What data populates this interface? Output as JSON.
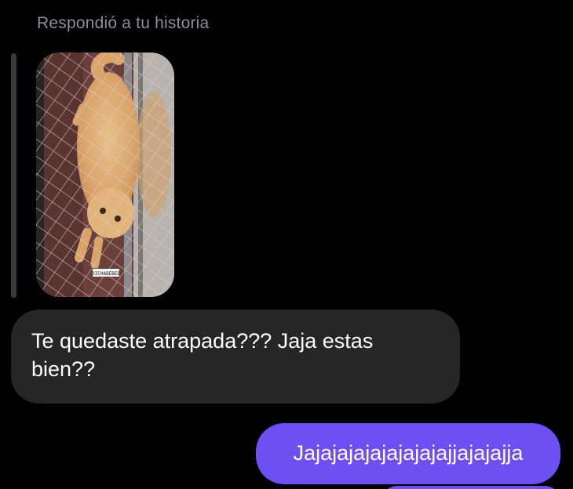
{
  "conversation": {
    "reply_context": "Respondió a tu historia",
    "story": {
      "watermark": "DICHABEBEB"
    },
    "messages": [
      {
        "direction": "received",
        "text": "Te quedaste atrapada??? Jaja estas bien??"
      },
      {
        "direction": "sent",
        "text": "Jajajajajajajajajajjajajajja"
      }
    ]
  },
  "colors": {
    "background": "#000000",
    "received_bubble": "#262626",
    "sent_bubble": "#6e4ff2",
    "secondary_text": "#8e8e93"
  }
}
